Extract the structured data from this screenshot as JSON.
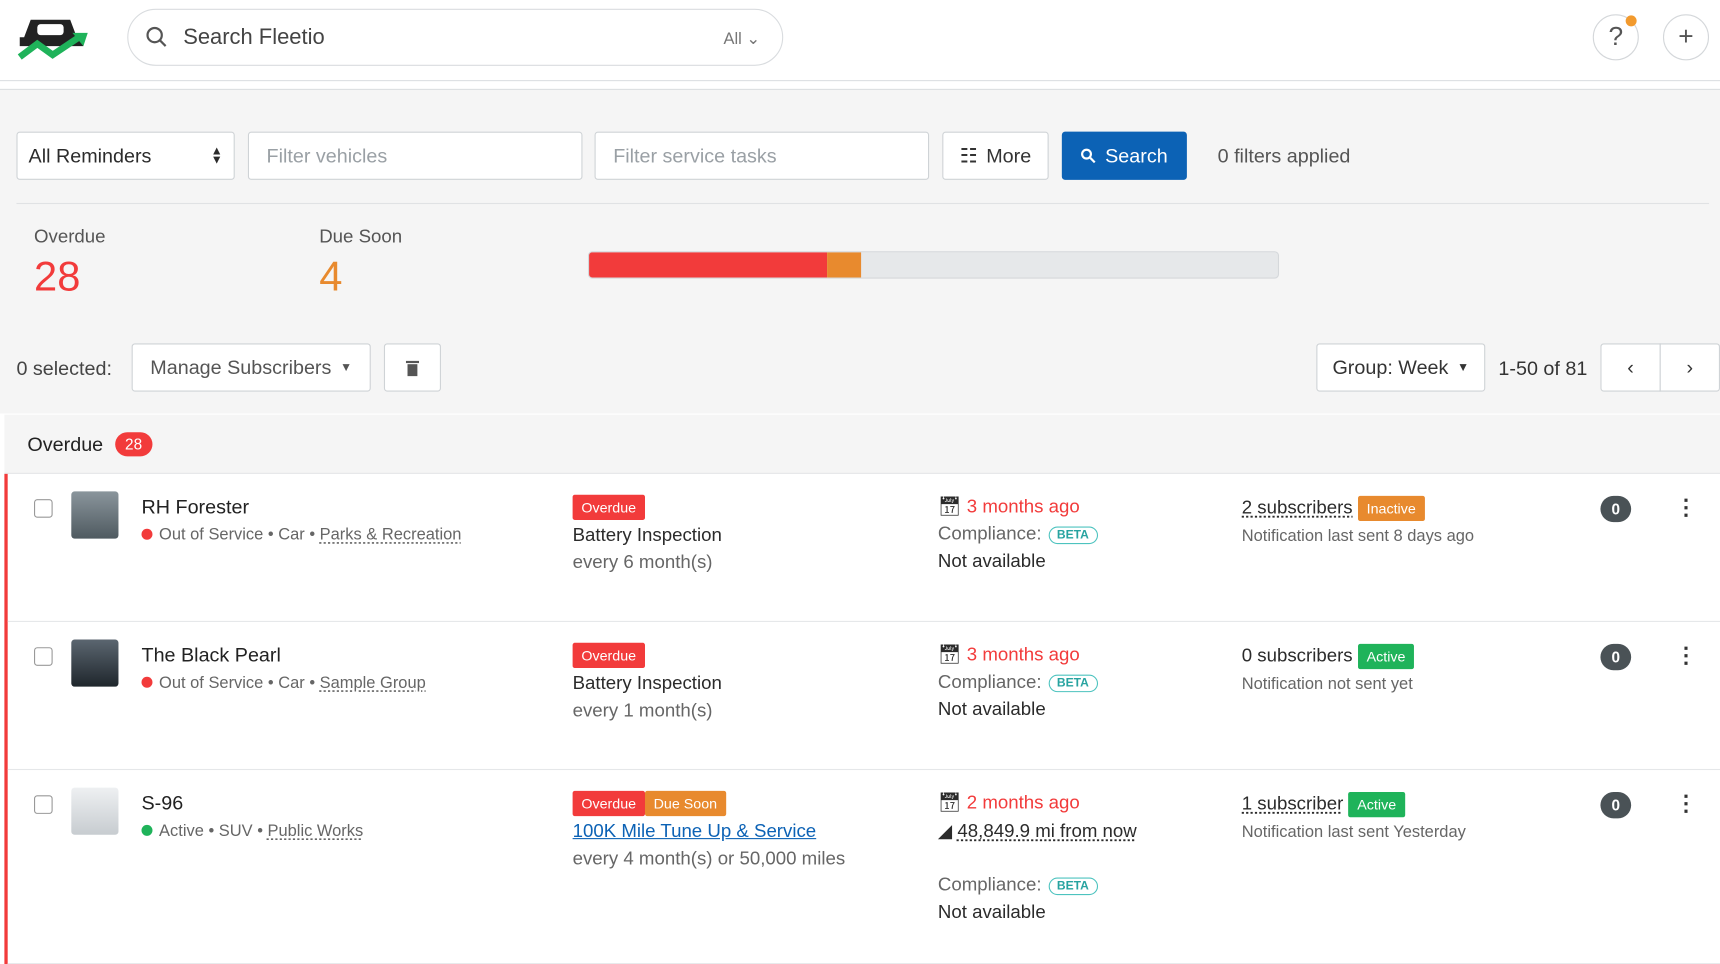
{
  "header": {
    "search_placeholder": "Search Fleetio",
    "search_scope": "All",
    "help": "?",
    "add": "+"
  },
  "filters": {
    "reminder_select": "All Reminders",
    "vehicle_placeholder": "Filter vehicles",
    "task_placeholder": "Filter service tasks",
    "more": "More",
    "search": "Search",
    "applied": "0 filters applied"
  },
  "summary": {
    "overdue_label": "Overdue",
    "overdue_count": "28",
    "due_soon_label": "Due Soon",
    "due_soon_count": "4",
    "bar_overdue_fraction": 0.346,
    "bar_due_soon_fraction": 0.049,
    "colors": {
      "overdue": "#f23b3b",
      "due_soon": "#e88a2e"
    }
  },
  "toolbar": {
    "selected": "0 selected:",
    "manage": "Manage Subscribers",
    "group": "Group: Week",
    "pagination": "1-50 of 81"
  },
  "group": {
    "label": "Overdue",
    "count": "28"
  },
  "rows": [
    {
      "name": "RH Forester",
      "status": "Out of Service",
      "type": "Car",
      "group": "Parks & Recreation",
      "status_color": "#f23b3b",
      "tags": [
        "Overdue"
      ],
      "task": "Battery Inspection",
      "interval": "every 6 month(s)",
      "due": "3 months ago",
      "compliance": "Compliance:",
      "beta": "BETA",
      "availability": "Not available",
      "subscribers": "2 subscribers",
      "sub_state": "Inactive",
      "notification": "Notification last sent 8 days ago",
      "count": "0"
    },
    {
      "name": "The Black Pearl",
      "status": "Out of Service",
      "type": "Car",
      "group": "Sample Group",
      "status_color": "#f23b3b",
      "tags": [
        "Overdue"
      ],
      "task": "Battery Inspection",
      "interval": "every 1 month(s)",
      "due": "3 months ago",
      "compliance": "Compliance:",
      "beta": "BETA",
      "availability": "Not available",
      "subscribers": "0 subscribers",
      "sub_state": "Active",
      "notification": "Notification not sent yet",
      "count": "0"
    },
    {
      "name": "S-96",
      "status": "Active",
      "type": "SUV",
      "group": "Public Works",
      "status_color": "#1fb35a",
      "tags": [
        "Overdue",
        "Due Soon"
      ],
      "task": "100K Mile Tune Up & Service",
      "interval": "every 4 month(s) or 50,000 miles",
      "due": "2 months ago",
      "meter": "48,849.9 mi from now",
      "compliance": "Compliance:",
      "beta": "BETA",
      "availability": "Not available",
      "subscribers": "1 subscriber",
      "sub_state": "Active",
      "notification": "Notification last sent Yesterday",
      "count": "0"
    }
  ]
}
